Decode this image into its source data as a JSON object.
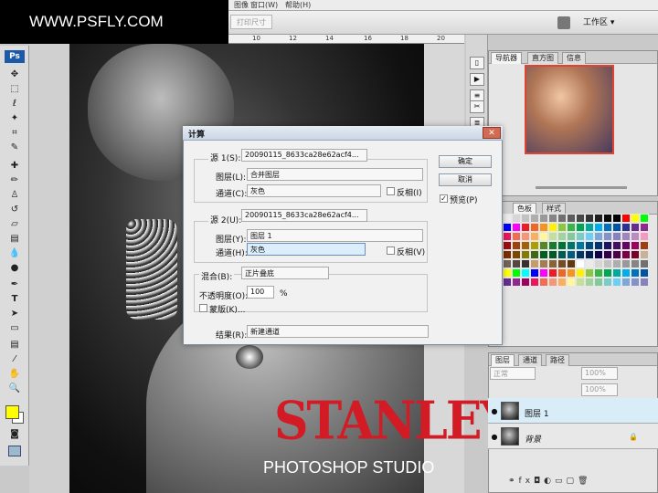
{
  "menubar": {
    "items": [
      "图像",
      "窗口(W)",
      "帮助(H)"
    ]
  },
  "watermark": {
    "text": "WWW.PSFLY.COM"
  },
  "options_bar": {
    "print_size": "打印尺寸",
    "workspace": "工作区 ▾"
  },
  "ruler": {
    "ticks": [
      "10",
      "12",
      "14",
      "16",
      "18",
      "20"
    ]
  },
  "toolbox": {
    "logo": "Ps"
  },
  "canvas": {
    "brand": "STANLEY",
    "studio": "PHOTOSHOP STUDIO"
  },
  "navigator": {
    "tabs": [
      "导航器",
      "直方图",
      "信息"
    ]
  },
  "swatches": {
    "tabs": [
      "色板",
      "样式"
    ],
    "colors": [
      "#ffffff",
      "#ebebeb",
      "#d6d6d6",
      "#c2c2c2",
      "#adadad",
      "#999999",
      "#858585",
      "#707070",
      "#5c5c5c",
      "#474747",
      "#333333",
      "#1f1f1f",
      "#0a0a0a",
      "#000000",
      "#ff0000",
      "#ffff00",
      "#00ff00",
      "#00ffff",
      "#0000ff",
      "#ff00ff",
      "#ed1c24",
      "#f26522",
      "#f7941d",
      "#fff200",
      "#8dc63f",
      "#39b54a",
      "#00a651",
      "#00a99d",
      "#00aeef",
      "#0072bc",
      "#0054a6",
      "#2e3192",
      "#662d91",
      "#92278f",
      "#9e005d",
      "#ed145b",
      "#f26c4f",
      "#f69679",
      "#fbaf5d",
      "#fff799",
      "#c4df9b",
      "#a3d39c",
      "#82ca9c",
      "#7accc8",
      "#6dcff6",
      "#7da7d9",
      "#8393ca",
      "#8781bd",
      "#a186be",
      "#bd8cbf",
      "#f49ac1",
      "#f5989d",
      "#9e0b0f",
      "#a0410d",
      "#a36209",
      "#aba000",
      "#598527",
      "#197b30",
      "#007236",
      "#00746b",
      "#0076a3",
      "#004b80",
      "#003471",
      "#1b1464",
      "#440e62",
      "#630460",
      "#9e005d",
      "#a0410d",
      "#790000",
      "#7b2e00",
      "#7d4900",
      "#827b00",
      "#406618",
      "#005e20",
      "#005826",
      "#005952",
      "#005b7f",
      "#003663",
      "#002157",
      "#0d004c",
      "#32004b",
      "#4b0049",
      "#7b0046",
      "#7a0026",
      "#c7b299",
      "#998675",
      "#736357",
      "#534741",
      "#37302d",
      "#c69c6d",
      "#a67c52",
      "#8c6239",
      "#754c24",
      "#603913",
      "#ffffff",
      "#ebebeb",
      "#d6d6d6",
      "#c2c2c2",
      "#adadad",
      "#999999",
      "#858585",
      "#707070",
      "#ff0000",
      "#ffff00",
      "#00ff00",
      "#00ffff",
      "#0000ff",
      "#ff00ff",
      "#ed1c24",
      "#f26522",
      "#f7941d",
      "#fff200",
      "#8dc63f",
      "#39b54a",
      "#00a651",
      "#00a99d",
      "#00aeef",
      "#0072bc",
      "#0054a6",
      "#2e3192",
      "#662d91",
      "#92278f",
      "#9e005d",
      "#ed145b",
      "#f26c4f",
      "#f69679",
      "#fbaf5d",
      "#fff799",
      "#c4df9b",
      "#a3d39c",
      "#82ca9c",
      "#7accc8",
      "#6dcff6",
      "#7da7d9",
      "#8393ca",
      "#8781bd"
    ]
  },
  "layers_panel": {
    "tabs": [
      "图层",
      "通道",
      "路径"
    ],
    "blend_mode": "正常",
    "opacity": "100%",
    "fill": "100%",
    "layers": [
      {
        "name": "图层 1"
      },
      {
        "name": "背景"
      }
    ]
  },
  "dialog": {
    "title": "计算",
    "source1": {
      "label": "源 1(S):",
      "value": "20090115_8633ca28e62acf4...",
      "layer_label": "图层(L):",
      "layer_value": "合并图层",
      "channel_label": "通道(C):",
      "channel_value": "灰色",
      "invert_label": "反相(I)"
    },
    "source2": {
      "label": "源 2(U):",
      "value": "20090115_8633ca28e62acf4...",
      "layer_label": "图层(Y):",
      "layer_value": "图层 1",
      "channel_label": "通道(H):",
      "channel_value": "灰色",
      "invert_label": "反相(V)"
    },
    "blend": {
      "label": "混合(B):",
      "value": "正片叠底",
      "opacity_label": "不透明度(O):",
      "opacity_value": "100",
      "opacity_unit": "%",
      "mask_label": "蒙版(K)..."
    },
    "result": {
      "label": "结果(R):",
      "value": "新建通道"
    },
    "ok_label": "确定",
    "cancel_label": "取消",
    "preview_label": "预览(P)",
    "preview_checked": "✓"
  }
}
